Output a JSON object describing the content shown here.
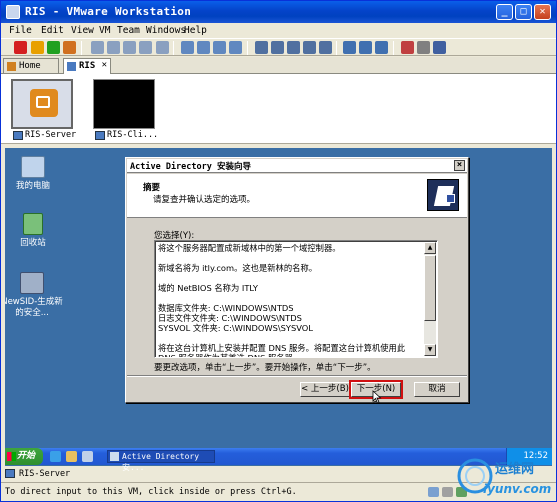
{
  "window": {
    "title": "RIS - VMware Workstation",
    "minimize": "_",
    "maximize": "□",
    "close": "✕"
  },
  "menu": [
    "File",
    "Edit",
    "View",
    "VM",
    "Team",
    "Windows",
    "Help"
  ],
  "tabs": [
    {
      "label": "Home",
      "active": false,
      "icon": "home-icon"
    },
    {
      "label": "RIS",
      "active": true,
      "icon": "vm-icon",
      "close": "✕"
    }
  ],
  "thumbnails": [
    {
      "label": "RIS-Server",
      "selected": true
    },
    {
      "label": "RIS-Cli...",
      "selected": false
    }
  ],
  "desktop_icons": [
    {
      "label": "我的电脑",
      "icon": "computer-icon"
    },
    {
      "label": "回收站",
      "icon": "recycle-bin-icon"
    },
    {
      "label": "NewSID-生成新的安全...",
      "icon": "newsid-icon"
    }
  ],
  "dialog": {
    "title": "Active Directory 安装向导",
    "close": "×",
    "header_title": "摘要",
    "header_subtitle": "请复查并确认选定的选项。",
    "selection_label": "您选择(Y):",
    "summary_text": "将这个服务器配置成新域林中的第一个域控制器。\n\n新域名将为 itly.com。这也是新林的名称。\n\n域的 NetBIOS 名称为 ITLY\n\n数据库文件夹: C:\\WINDOWS\\NTDS\n日志文件文件夹: C:\\WINDOWS\\NTDS\nSYSVOL 文件夹: C:\\WINDOWS\\SYSVOL\n\n将在这台计算机上安装并配置 DNS 服务。将配置这台计算机使用此 DNS 服务器作为其首选 DNS 服务器。",
    "hint": "要更改选项，单击“上一步”。要开始操作，单击“下一步”。",
    "buttons": {
      "back": "< 上一步(B)",
      "next": "下一步(N) >",
      "cancel": "取消"
    }
  },
  "guest_taskbar": {
    "start": "开始",
    "task_item": "Active Directory 安...",
    "clock": "12:52"
  },
  "vm_list_item": "RIS-Server",
  "status_text": "To direct input to this VM, click inside or press Ctrl+G.",
  "watermark": {
    "brand": "运维网",
    "url": "iyunv.com"
  },
  "colors": {
    "titlebar": "#0443c9",
    "desktop": "#3a6ea5",
    "highlight": "#d01010",
    "dialog_bg": "#d4d0c8"
  }
}
